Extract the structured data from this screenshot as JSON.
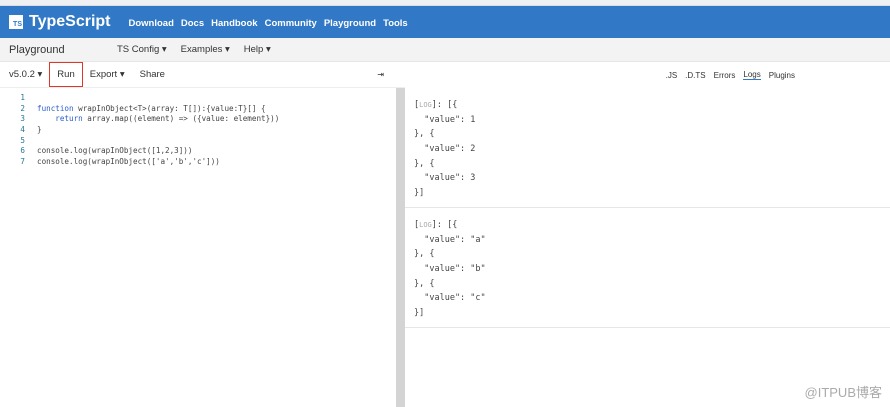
{
  "header": {
    "logo_badge": "TS",
    "logo": "TypeScript",
    "nav": [
      "Download",
      "Docs",
      "Handbook",
      "Community",
      "Playground",
      "Tools"
    ]
  },
  "playground_bar": {
    "title": "Playground",
    "menus": [
      "TS Config ▾",
      "Examples ▾",
      "Help ▾"
    ]
  },
  "toolbar": {
    "version": "v5.0.2 ▾",
    "run": "Run",
    "export": "Export ▾",
    "share": "Share",
    "collapse": "⇥"
  },
  "editor": {
    "lines": [
      {
        "n": "1",
        "kw": "",
        "text": ""
      },
      {
        "n": "2",
        "kw": "function",
        "text": " wrapInObject<T>(array: T[]):{value:T}[] {"
      },
      {
        "n": "3",
        "kw": "    return",
        "text": " array.map((element) => ({value: element}))"
      },
      {
        "n": "4",
        "kw": "",
        "text": "}"
      },
      {
        "n": "5",
        "kw": "",
        "text": ""
      },
      {
        "n": "6",
        "kw": "",
        "text": "console.log(wrapInObject([1,2,3]))"
      },
      {
        "n": "7",
        "kw": "",
        "text": "console.log(wrapInObject(['a','b','c']))"
      }
    ]
  },
  "output": {
    "tabs": [
      ".JS",
      ".D.TS",
      "Errors",
      "Logs",
      "Plugins"
    ],
    "active_tab": "Logs",
    "logs": [
      {
        "tag": "LOG",
        "lines": [
          "]: [{",
          "  \"value\": 1",
          "}, {",
          "  \"value\": 2",
          "}, {",
          "  \"value\": 3",
          "}]"
        ]
      },
      {
        "tag": "LOG",
        "lines": [
          "]: [{",
          "  \"value\": \"a\"",
          "}, {",
          "  \"value\": \"b\"",
          "}, {",
          "  \"value\": \"c\"",
          "}]"
        ]
      }
    ]
  },
  "watermark": "@ITPUB博客"
}
